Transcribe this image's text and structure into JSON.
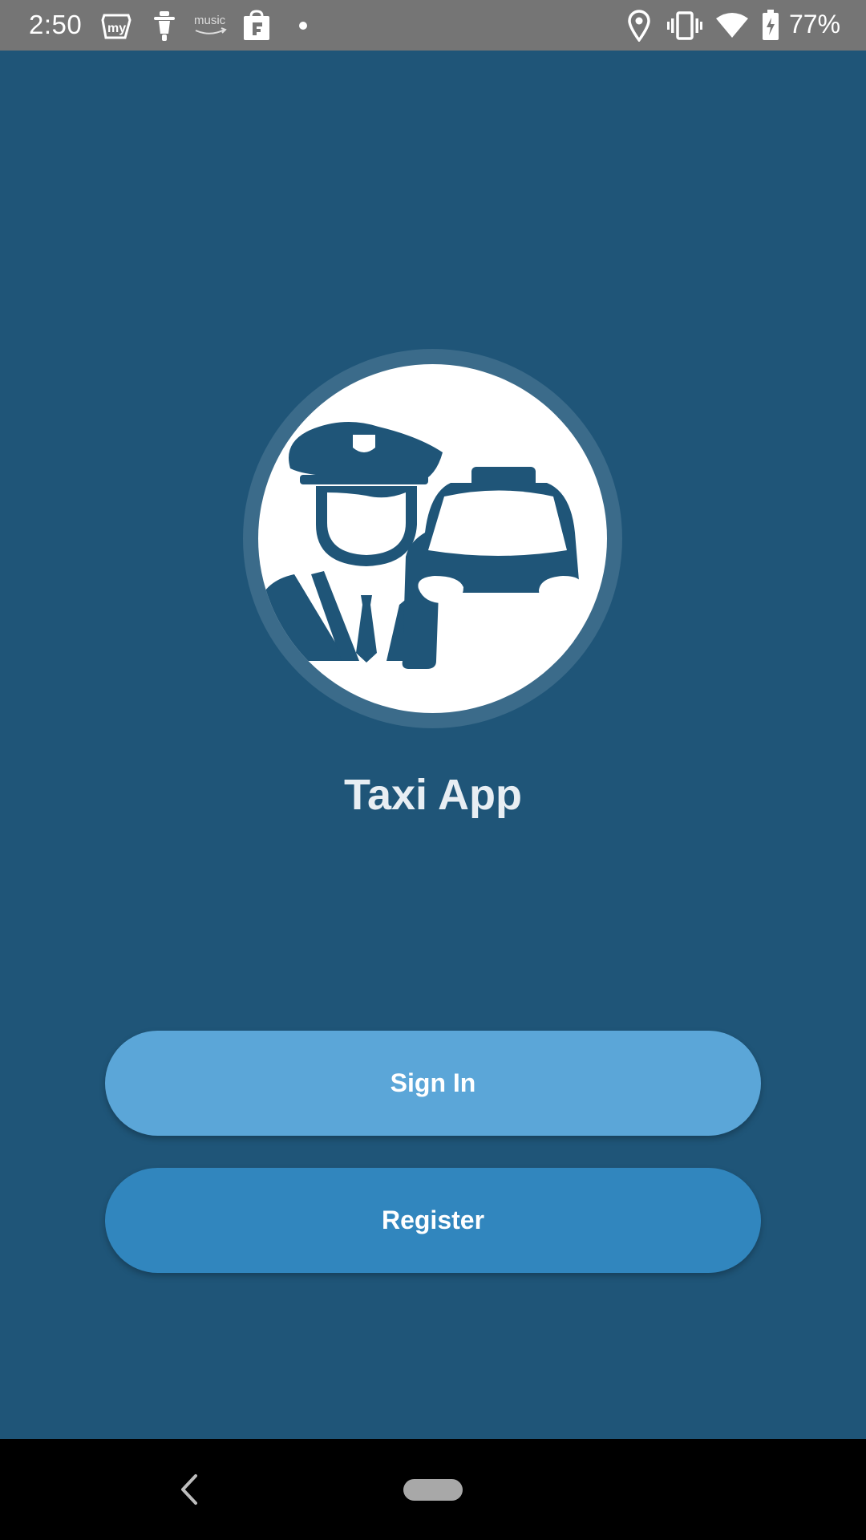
{
  "status_bar": {
    "time": "2:50",
    "notification_icons": [
      "myntra-icon",
      "scooter-icon",
      "amazon-music-icon",
      "shopping-bag-icon",
      "dot-icon"
    ],
    "music_label": "music",
    "system_icons": [
      "location-icon",
      "vibrate-icon",
      "wifi-icon",
      "battery-charging-icon"
    ],
    "battery_percent": "77%"
  },
  "logo": {
    "icon": "taxi-driver-icon"
  },
  "app": {
    "title": "Taxi App"
  },
  "buttons": {
    "sign_in_label": "Sign In",
    "register_label": "Register"
  },
  "navigation": {
    "back_icon": "back-chevron-icon",
    "home_icon": "home-pill-icon"
  },
  "colors": {
    "background": "#1f5578",
    "status_bar": "#757575",
    "sign_in_button": "#5ba6d8",
    "register_button": "#3186be",
    "logo_ring": "#3b6b8a"
  }
}
